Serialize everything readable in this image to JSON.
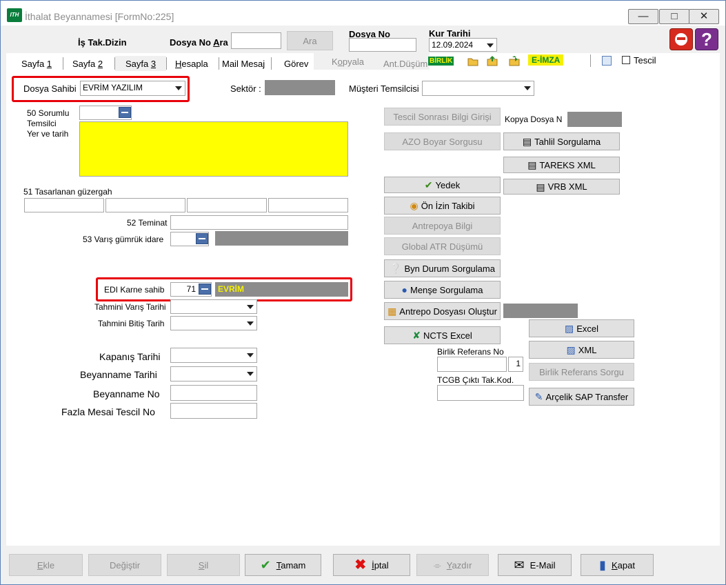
{
  "window": {
    "title": "İthalat Beyannamesi [FormNo:225]",
    "icon_text": "ITH"
  },
  "header": {
    "is_tak_dizin": "İş Tak.Dizin",
    "dosya_no_ara_prefix": "Dosya No ",
    "dosya_no_ara_underlined": "A",
    "dosya_no_ara_suffix": "ra",
    "ara_button": "Ara",
    "dosya_no_label": "Dosya No",
    "kur_tarihi_label": "Kur Tarihi",
    "kur_tarihi_value": "12.09.2024"
  },
  "tabs": [
    {
      "pre": "Sayfa ",
      "u": "1",
      "post": ""
    },
    {
      "pre": "Sayfa ",
      "u": "2",
      "post": ""
    },
    {
      "pre": "Sayfa ",
      "u": "3",
      "post": ""
    },
    {
      "pre": "",
      "u": "H",
      "post": "esapla"
    },
    {
      "pre": "Mail Mesaj",
      "u": "",
      "post": ""
    },
    {
      "pre": "Görev",
      "u": "",
      "post": ""
    },
    {
      "pre": "K",
      "u": "o",
      "post": "pyala"
    },
    {
      "pre": "Ant.Düşüm",
      "u": "",
      "post": ""
    }
  ],
  "toolbar": {
    "birlik_badge": "BİRLİK",
    "eimza_badge": "E-İMZA",
    "tescil_label": "Tescil"
  },
  "top_row": {
    "dosya_sahibi_label": "Dosya Sahibi",
    "dosya_sahibi_value": "EVRİM YAZILIM",
    "sektor_label": "Sektör :",
    "musteri_temsilcisi_label": "Müşteri Temsilcisi"
  },
  "left": {
    "sorumlu_line1": "50 Sorumlu",
    "sorumlu_line2": "Temsilci",
    "sorumlu_line3": "Yer ve tarih",
    "tasarlanan_label": "51 Tasarlanan güzergah",
    "teminat_label": "52 Teminat",
    "varis_label": "53 Varış gümrük idare",
    "edi_label": "EDI Karne sahib",
    "edi_code": "71",
    "edi_name": "EVRİM",
    "tahmini_varis_label": "Tahmini Varış Tarihi",
    "tahmini_bitis_label": "Tahmini Bitiş Tarih",
    "kapanis_label": "Kapanış Tarihi",
    "beyanname_tarihi_label": "Beyanname Tarihi",
    "beyanname_no_label": "Beyanname No",
    "fazla_mesai_label": "Fazla Mesai Tescil No"
  },
  "right": {
    "tescil_sonrasi": "Tescil Sonrası Bilgi Girişi",
    "kopya_dosya_label": "Kopya Dosya N",
    "azo_boyar": "AZO Boyar Sorgusu",
    "tahlil": "Tahlil Sorgulama",
    "tareks": "TAREKS XML",
    "yedek": "Yedek",
    "vrb": "VRB XML",
    "on_izin": "Ön İzin Takibi",
    "antrepoya": "Antrepoya Bilgi",
    "global_atr": "Global ATR Düşümü",
    "byn_durum": "Byn Durum Sorgulama",
    "mense": "Menşe Sorgulama",
    "antrepo_dosyasi": "Antrepo Dosyası Oluştur",
    "excel": "Excel",
    "ncts": "NCTS Excel",
    "xml": "XML",
    "birlik_ref_label": "Birlik Referans No",
    "birlik_ref_count": "1",
    "birlik_ref_sorgu": "Birlik Referans Sorgu",
    "tcgb_label": "TCGB Çıktı Tak.Kod.",
    "arcelik": "Arçelik SAP Transfer"
  },
  "bottom": {
    "ekle_u": "E",
    "ekle_rest": "kle",
    "degistir_pre": "De",
    "degistir_u": "ğ",
    "degistir_post": "iştir",
    "sil_u": "S",
    "sil_rest": "il",
    "tamam_u": "T",
    "tamam_rest": "amam",
    "iptal_u": "İ",
    "iptal_rest": "ptal",
    "yazdir_u": "Y",
    "yazdir_rest": "azdır",
    "email": "E-Mail",
    "kapat_u": "K",
    "kapat_rest": "apat"
  }
}
